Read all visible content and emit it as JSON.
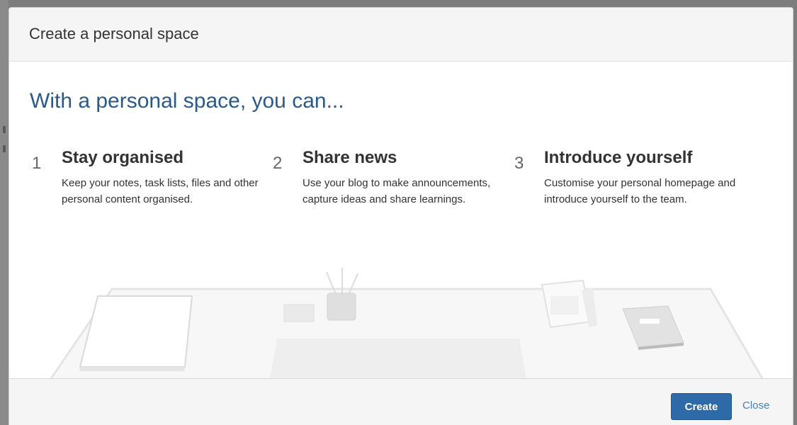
{
  "dialog": {
    "title": "Create a personal space"
  },
  "intro": {
    "heading": "With a personal space, you can..."
  },
  "features": [
    {
      "number": "1",
      "title": "Stay organised",
      "description": "Keep your notes, task lists, files and other personal content organised."
    },
    {
      "number": "2",
      "title": "Share news",
      "description": "Use your blog to make announcements, capture ideas and share learnings."
    },
    {
      "number": "3",
      "title": "Introduce yourself",
      "description": "Customise your personal homepage and introduce yourself to the team."
    }
  ],
  "footer": {
    "create_label": "Create",
    "close_label": "Close"
  },
  "colors": {
    "accent": "#2f6aa8",
    "heading": "#2a5a8a",
    "link": "#4a80b8"
  }
}
